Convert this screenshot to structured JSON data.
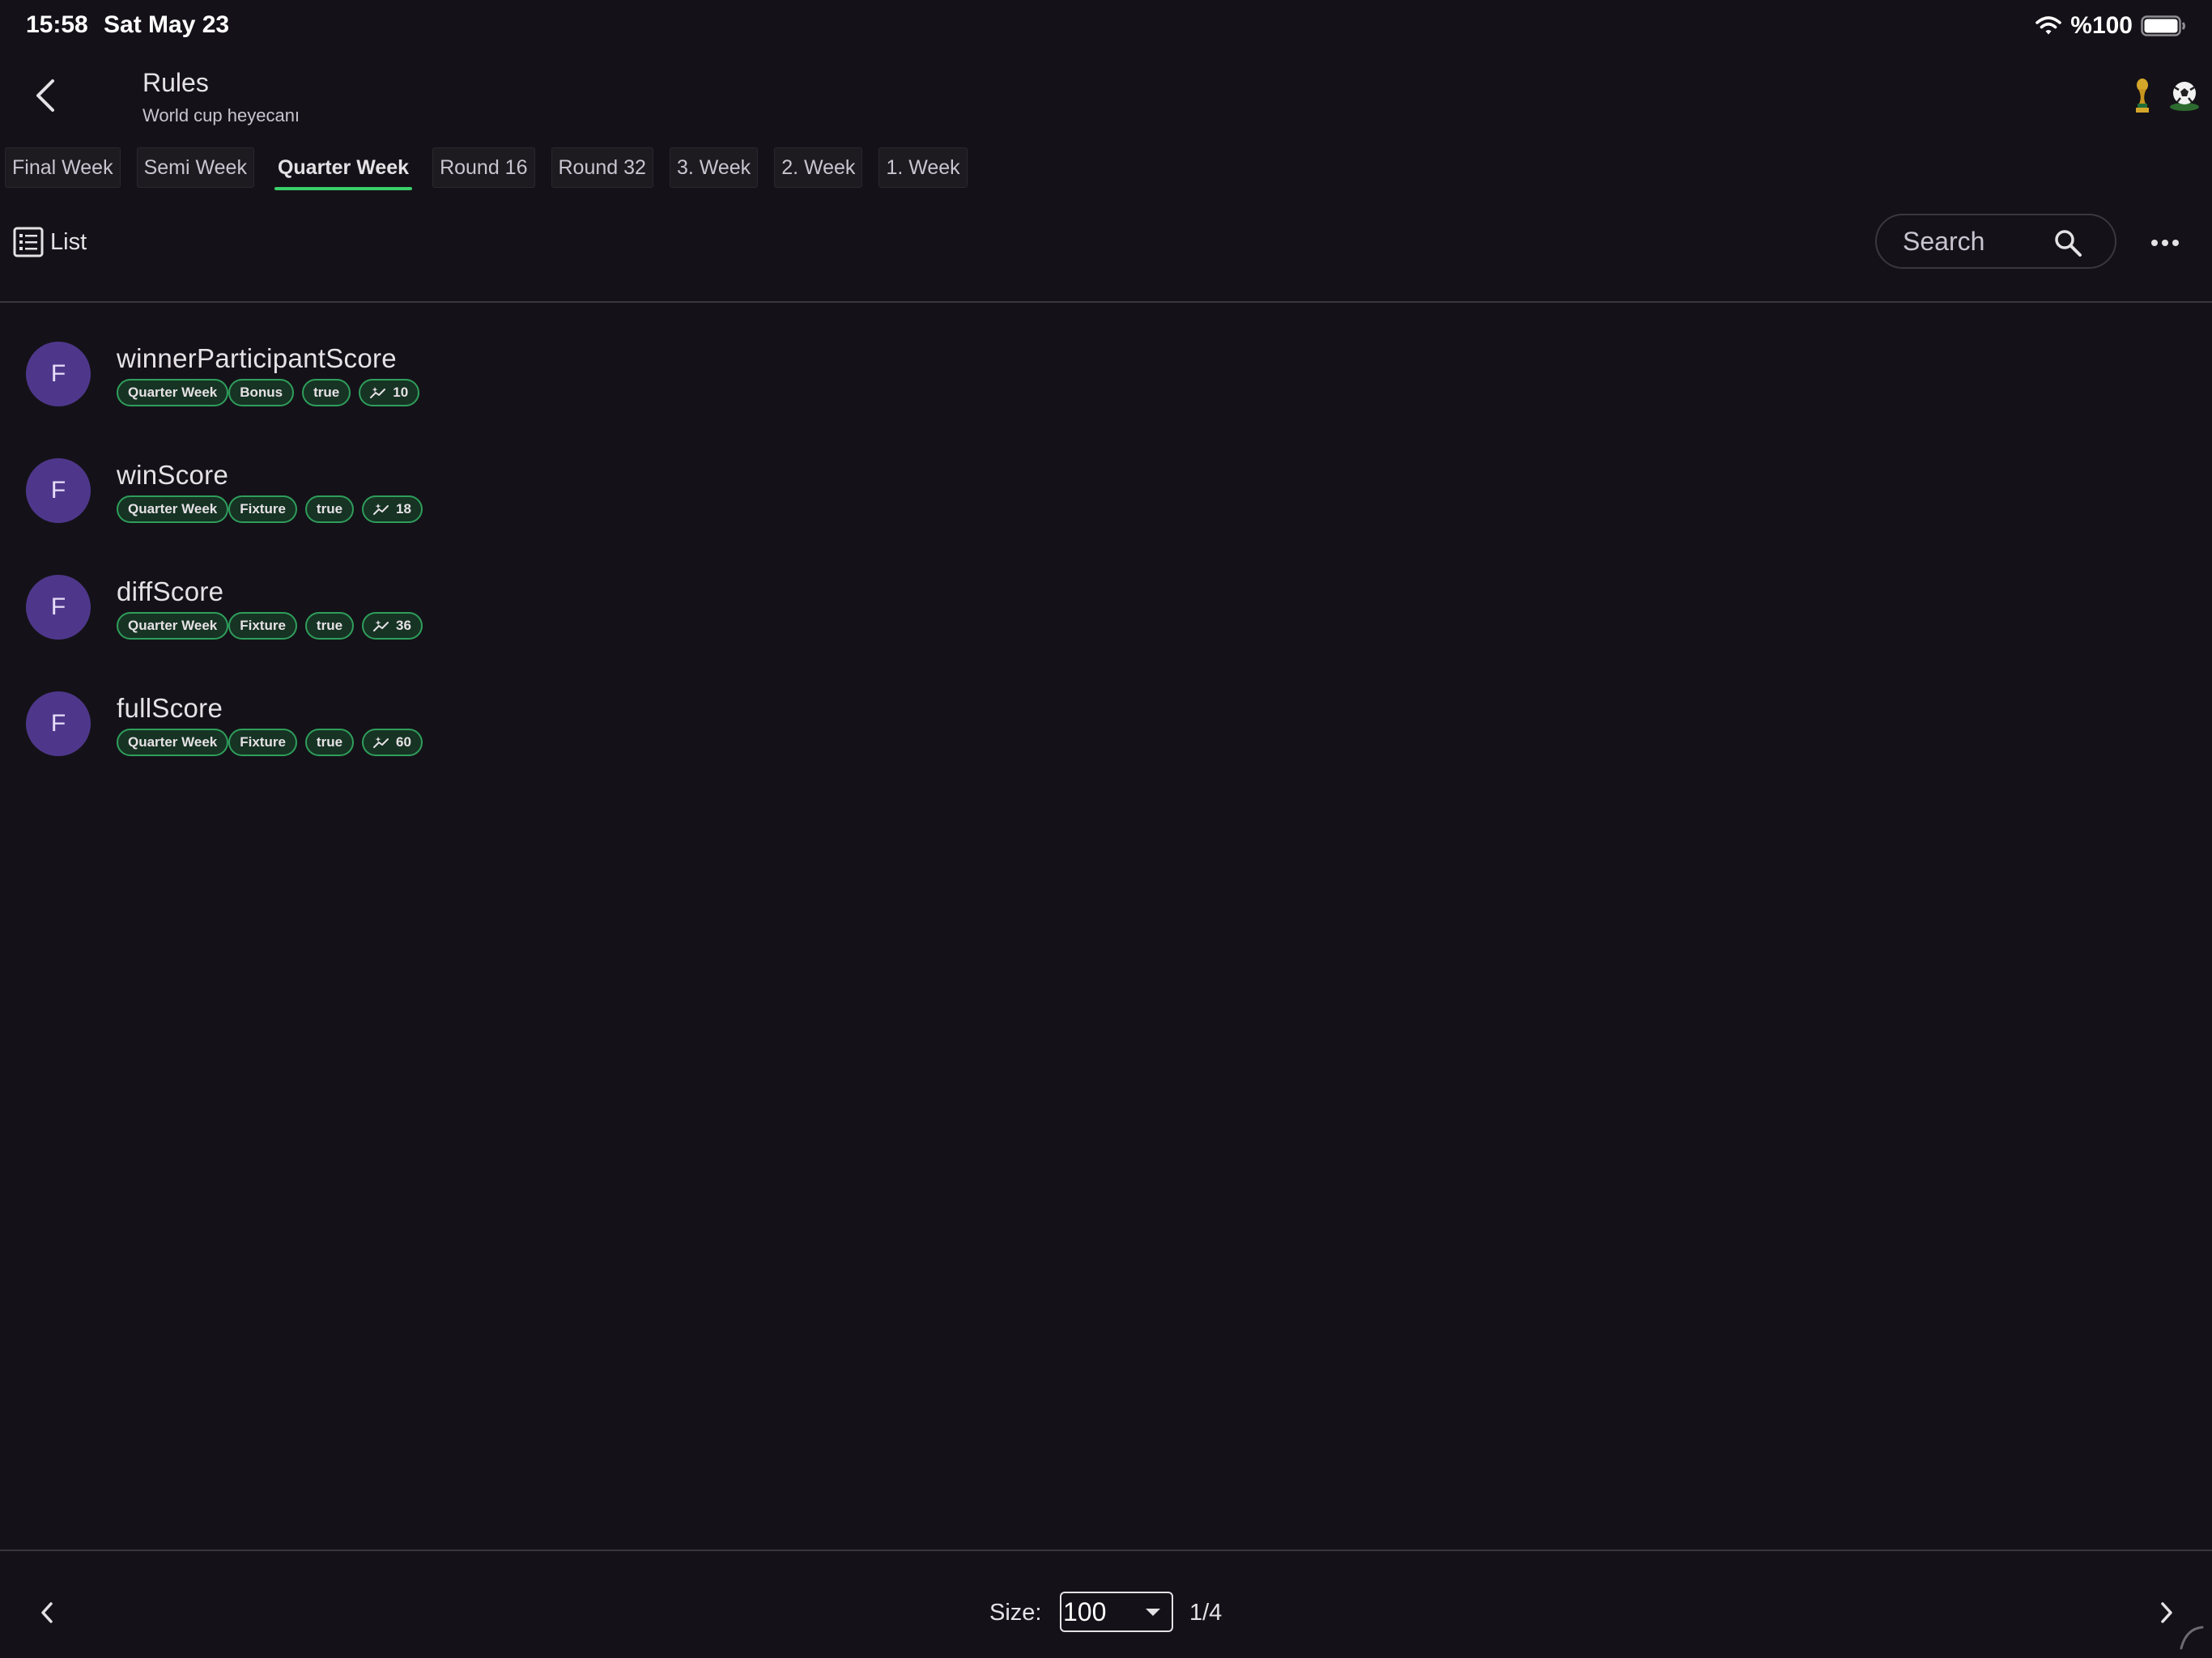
{
  "status_bar": {
    "time": "15:58",
    "date": "Sat May 23",
    "battery_text": "%100"
  },
  "header": {
    "title": "Rules",
    "subtitle": "World cup heyecanı",
    "icons": [
      "back-icon",
      "trophy-icon",
      "soccer-ball-icon"
    ]
  },
  "tabs": [
    {
      "label": "Final Week",
      "active": false
    },
    {
      "label": "Semi Week",
      "active": false
    },
    {
      "label": "Quarter Week",
      "active": true
    },
    {
      "label": "Round 16",
      "active": false
    },
    {
      "label": "Round 32",
      "active": false
    },
    {
      "label": "3. Week",
      "active": false
    },
    {
      "label": "2. Week",
      "active": false
    },
    {
      "label": "1. Week",
      "active": false
    }
  ],
  "toolbar": {
    "view_label": "List",
    "search_placeholder": "Search"
  },
  "rules": [
    {
      "avatar": "F",
      "name": "winnerParticipantScore",
      "week": "Quarter Week",
      "type": "Bonus",
      "enabled": "true",
      "score": "10"
    },
    {
      "avatar": "F",
      "name": "winScore",
      "week": "Quarter Week",
      "type": "Fixture",
      "enabled": "true",
      "score": "18"
    },
    {
      "avatar": "F",
      "name": "diffScore",
      "week": "Quarter Week",
      "type": "Fixture",
      "enabled": "true",
      "score": "36"
    },
    {
      "avatar": "F",
      "name": "fullScore",
      "week": "Quarter Week",
      "type": "Fixture",
      "enabled": "true",
      "score": "60"
    }
  ],
  "pagination": {
    "size_label": "Size:",
    "size_value": "100",
    "page": "1/4"
  },
  "colors": {
    "background": "#141218",
    "accent": "#3ad06a",
    "avatar": "#4e378b",
    "chip_border": "#2f9e5b",
    "chip_bg": "#163324"
  }
}
